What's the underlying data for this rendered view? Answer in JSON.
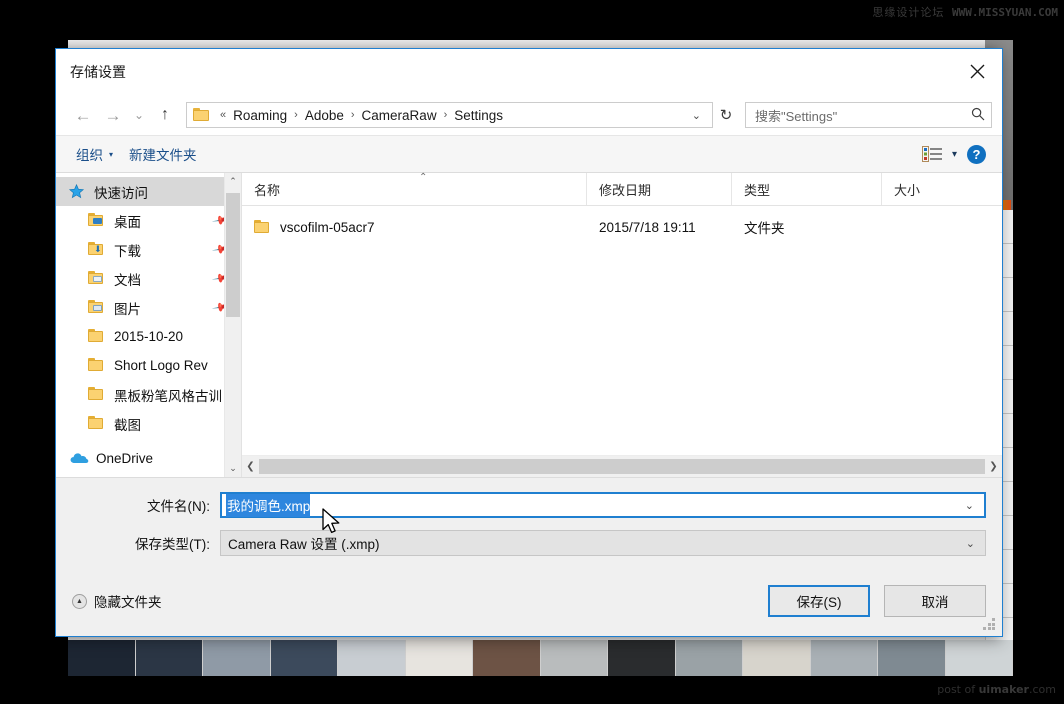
{
  "watermarks": {
    "top": "思缘设计论坛",
    "top_url": "WWW.MISSYUAN.COM",
    "bottom_prefix": "post of ",
    "bottom_brand": "uimaker",
    "bottom_suffix": ".com"
  },
  "dialog": {
    "title": "存储设置",
    "close_label": "×"
  },
  "nav": {
    "back_label": "←",
    "forward_label": "→",
    "recent_label": "⌄",
    "up_label": "↑",
    "address": {
      "prefix": "«",
      "crumbs": [
        "Roaming",
        "Adobe",
        "CameraRaw",
        "Settings"
      ],
      "separator": "›",
      "dropdown_label": "⌄",
      "refresh_label": "↻"
    },
    "search": {
      "placeholder": "搜索\"Settings\"",
      "icon": "search-icon"
    }
  },
  "commandbar": {
    "organize_label": "组织",
    "organize_caret": "▾",
    "new_folder_label": "新建文件夹",
    "view_icon": "view-list-icon",
    "view_caret": "▾",
    "help_label": "?"
  },
  "navpane": {
    "items": [
      {
        "label": "快速访问",
        "icon": "star-icon",
        "level": 0,
        "selected": true,
        "pinned": false
      },
      {
        "label": "桌面",
        "icon": "folder-desktop-icon",
        "level": 1,
        "selected": false,
        "pinned": true
      },
      {
        "label": "下载",
        "icon": "folder-downloads-icon",
        "level": 1,
        "selected": false,
        "pinned": true
      },
      {
        "label": "文档",
        "icon": "folder-documents-icon",
        "level": 1,
        "selected": false,
        "pinned": true
      },
      {
        "label": "图片",
        "icon": "folder-pictures-icon",
        "level": 1,
        "selected": false,
        "pinned": true
      },
      {
        "label": "2015-10-20",
        "icon": "folder-icon",
        "level": 1,
        "selected": false,
        "pinned": false
      },
      {
        "label": "Short Logo Rev",
        "icon": "folder-icon",
        "level": 1,
        "selected": false,
        "pinned": false
      },
      {
        "label": "黑板粉笔风格古训",
        "icon": "folder-icon",
        "level": 1,
        "selected": false,
        "pinned": false
      },
      {
        "label": "截图",
        "icon": "folder-icon",
        "level": 1,
        "selected": false,
        "pinned": false
      },
      {
        "label": "OneDrive",
        "icon": "cloud-icon",
        "level": 0,
        "selected": false,
        "pinned": false
      }
    ],
    "scroll_up": "⌃",
    "scroll_down": "⌄"
  },
  "filelist": {
    "columns": [
      "名称",
      "修改日期",
      "类型",
      "大小"
    ],
    "sort_indicator": "⌃",
    "rows": [
      {
        "name": "vscofilm-05acr7",
        "date": "2015/7/18 19:11",
        "type": "文件夹",
        "size": "",
        "icon": "folder-icon"
      }
    ],
    "hscroll_left": "❮",
    "hscroll_right": "❯"
  },
  "form": {
    "filename_label": "文件名(N):",
    "filename_value": "我的调色.xmp",
    "filename_caret": "⌄",
    "filetype_label": "保存类型(T):",
    "filetype_value": "Camera Raw 设置 (.xmp)",
    "filetype_caret": "⌄"
  },
  "actions": {
    "hide_folders_label": "隐藏文件夹",
    "hide_folders_icon": "chevron-up-circle-icon",
    "save_label": "保存(S)",
    "cancel_label": "取消",
    "resize_grip": "resize-grip-icon"
  },
  "colors": {
    "accent": "#1f7fd0",
    "selection": "#2e86de",
    "link": "#1b4f8a",
    "folder": "#fbd271",
    "help": "#1070c0"
  }
}
